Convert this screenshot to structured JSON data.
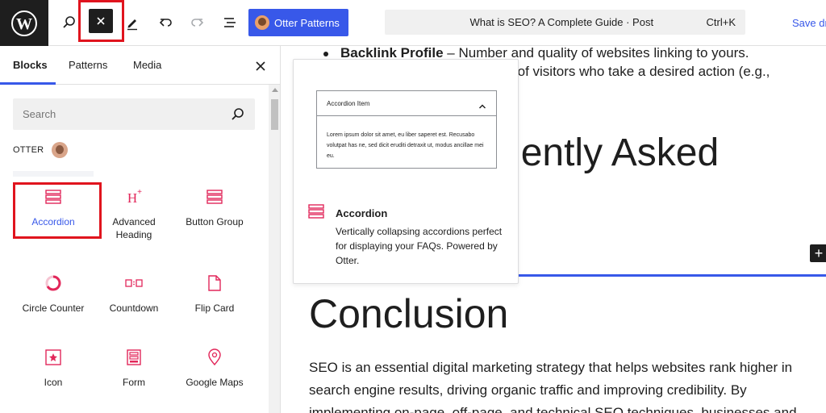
{
  "toolbar": {
    "logo_icon": "wordpress-logo-icon",
    "otter_patterns_label": "Otter Patterns",
    "document_title": "What is SEO? A Complete Guide · Post",
    "shortcut": "Ctrl+K",
    "save_label": "Save draft",
    "accent_color": "#3858e9"
  },
  "inserter": {
    "tabs": [
      {
        "label": "Blocks",
        "active": true
      },
      {
        "label": "Patterns",
        "active": false
      },
      {
        "label": "Media",
        "active": false
      }
    ],
    "search_placeholder": "Search",
    "category_label": "OTTER",
    "blocks": [
      {
        "label": "Accordion",
        "icon": "accordion-icon",
        "selected": true
      },
      {
        "label": "Advanced Heading",
        "icon": "heading-icon",
        "selected": false
      },
      {
        "label": "Button Group",
        "icon": "button-group-icon",
        "selected": false
      },
      {
        "label": "Circle Counter",
        "icon": "circle-counter-icon",
        "selected": false
      },
      {
        "label": "Countdown",
        "icon": "countdown-icon",
        "selected": false
      },
      {
        "label": "Flip Card",
        "icon": "flip-card-icon",
        "selected": false
      },
      {
        "label": "Icon",
        "icon": "icon-block-icon",
        "selected": false
      },
      {
        "label": "Form",
        "icon": "form-icon",
        "selected": false
      },
      {
        "label": "Google Maps",
        "icon": "map-pin-icon",
        "selected": false
      }
    ],
    "icon_color": "#e2275a"
  },
  "preview": {
    "item_title": "Accordion Item",
    "item_body": "Lorem ipsum dolor sit amet, eu liber saperet est. Recusabo volutpat has ne, sed dicit eruditi detraxit ut, modus ancillae mei eu.",
    "block_name": "Accordion",
    "description": "Vertically collapsing accordions perfect for displaying your FAQs. Powered by Otter."
  },
  "canvas": {
    "bullet_bold": "Backlink Profile",
    "bullet_rest": " – Number and quality of websites linking to yours.",
    "bullet2_text": "ge of visitors who take a desired action (e.g.,",
    "faq_heading_visible": "uently Asked",
    "conclusion_heading": "Conclusion",
    "paragraph": "SEO is an essential digital marketing strategy that helps websites rank higher in search engine results, driving organic traffic and improving credibility. By implementing on-page, off-page, and technical SEO techniques, businesses and"
  }
}
